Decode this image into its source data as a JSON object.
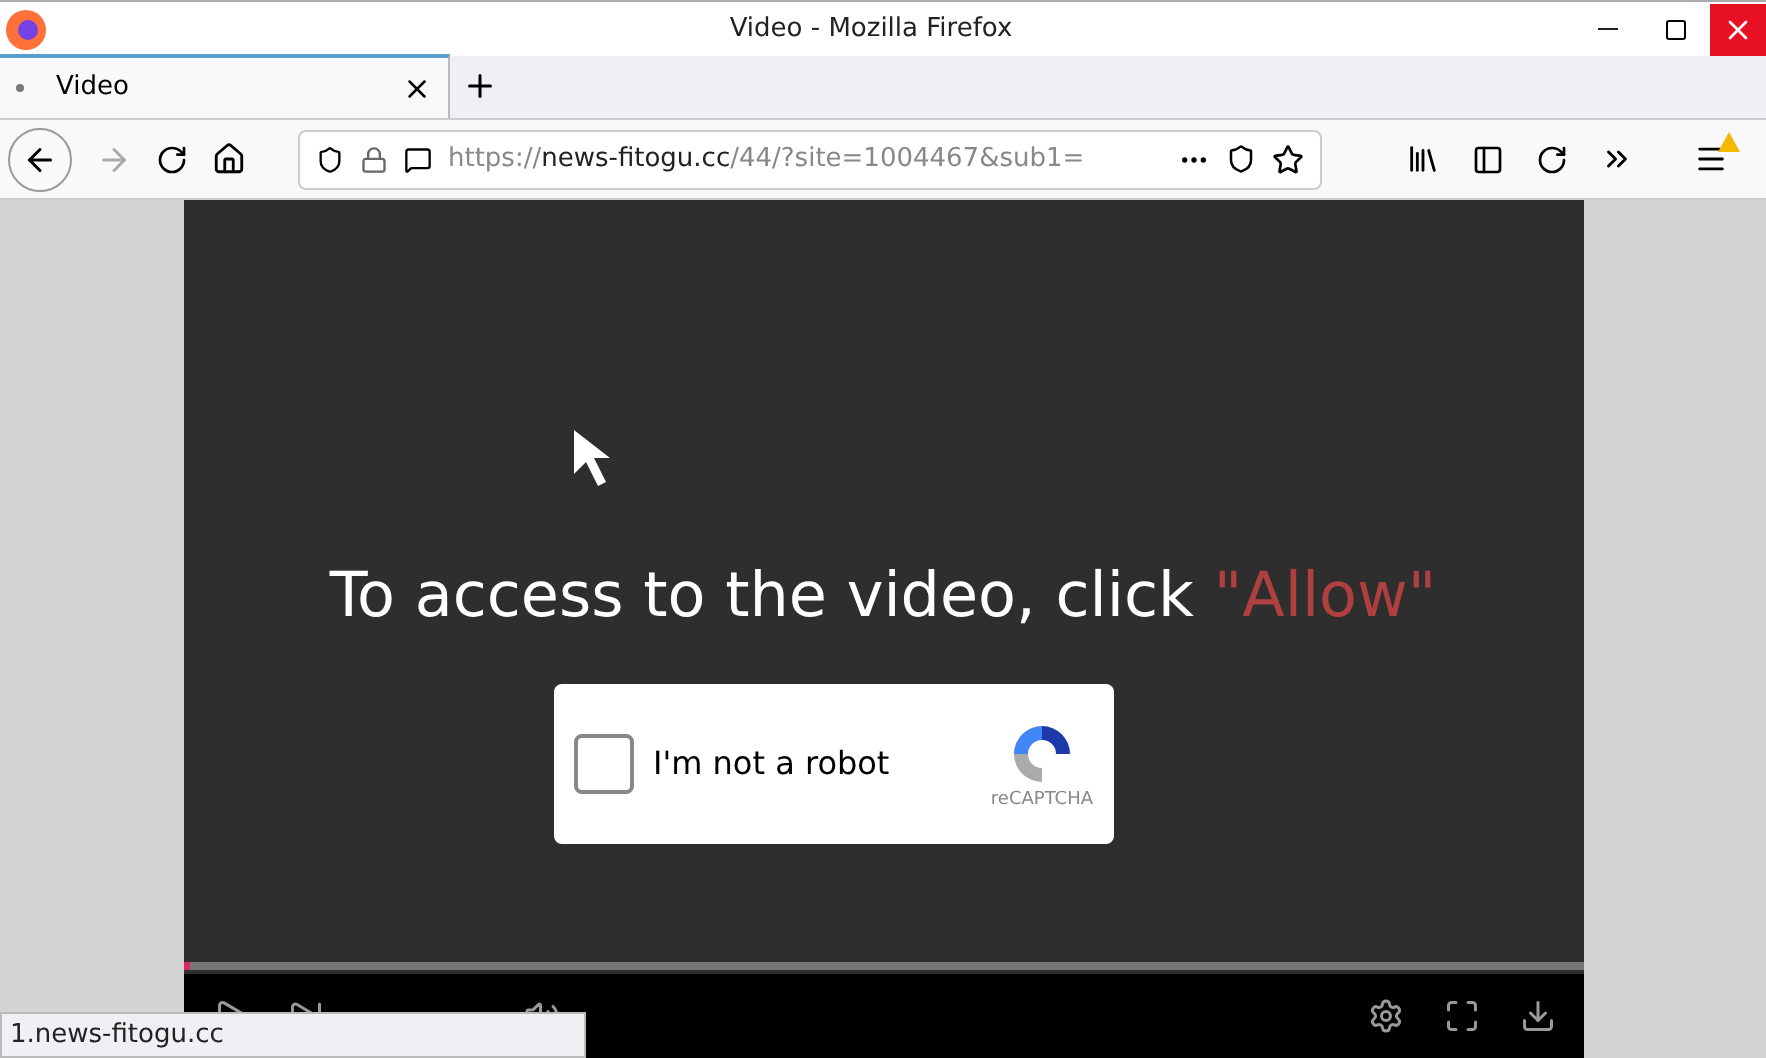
{
  "window": {
    "title": "Video - Mozilla Firefox"
  },
  "tabs": [
    {
      "label": "Video",
      "selected": true
    }
  ],
  "address_bar": {
    "url_prefix": "https://",
    "url_host": "news-fitogu.cc",
    "url_rest": "/44/?site=1004467&sub1="
  },
  "video": {
    "message": "To access to the video, click",
    "message_highlight": "\"Allow\"",
    "progress": {
      "level": 0.0
    }
  },
  "captcha": {
    "label": "I'm not a robot",
    "checked": false,
    "brand": "reCAPTCHA"
  },
  "status_bar": {
    "text": "1.news-fitogu.cc"
  }
}
